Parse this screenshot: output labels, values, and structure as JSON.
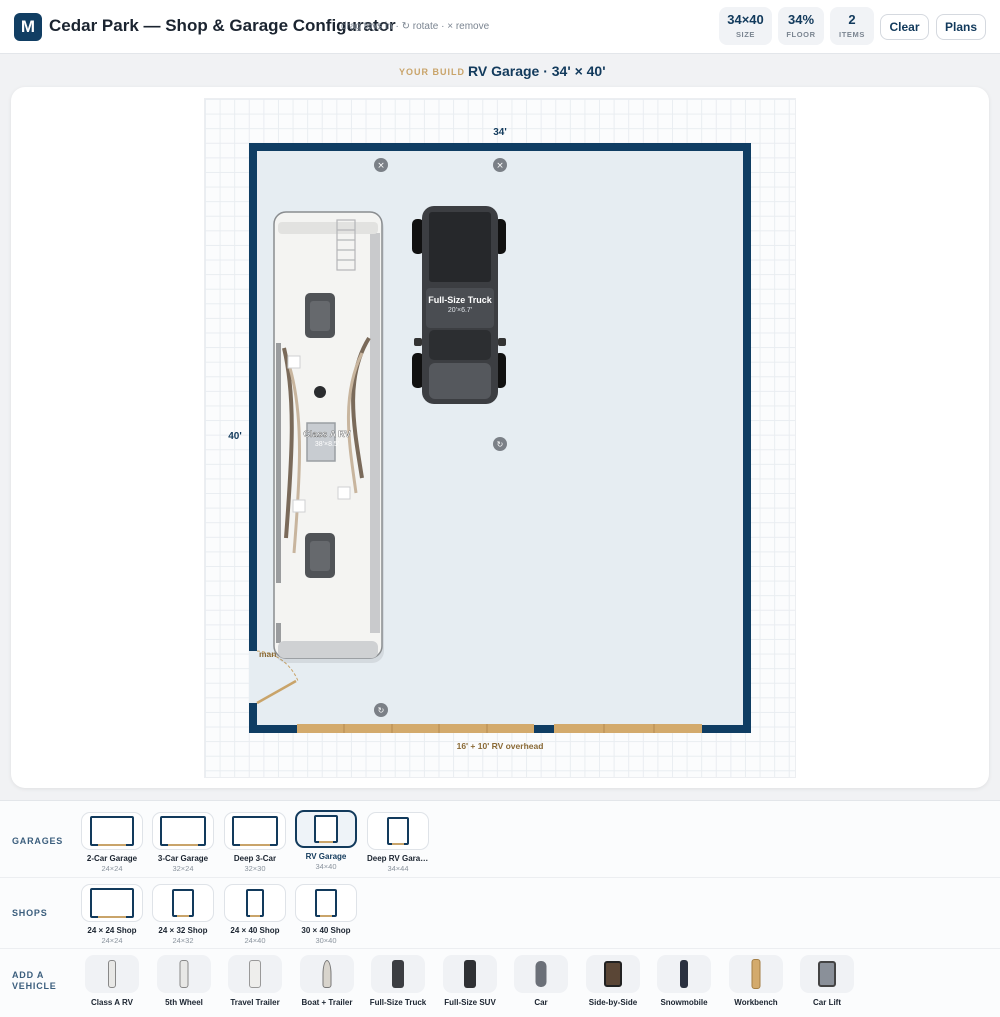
{
  "header": {
    "logo_letter": "M",
    "title": "Cedar Park — Shop & Garage Configurator",
    "hint": "drag toys in · ↻ rotate · × remove",
    "stats": [
      {
        "value": "34×40",
        "label": "SIZE"
      },
      {
        "value": "34%",
        "label": "FLOOR"
      },
      {
        "value": "2",
        "label": "ITEMS"
      }
    ],
    "clear_label": "Clear",
    "plans_label": "Plans"
  },
  "build": {
    "kicker": "YOUR BUILD",
    "name": "RV Garage · 34' × 40'"
  },
  "plan": {
    "width_label": "34'",
    "depth_label": "40'",
    "door_label": "man door",
    "overhead_label": "16' + 10' RV overhead",
    "items": [
      {
        "name": "Class A RV",
        "dims": "38'×8.5'"
      },
      {
        "name": "Full-Size Truck",
        "dims": "20'×6.7'"
      }
    ],
    "colors": {
      "wall": "#0f3d63",
      "floor": "#e6edf2",
      "door": "#d3aa6c"
    }
  },
  "garages": {
    "label": "GARAGES",
    "options": [
      {
        "name": "2-Car Garage",
        "dims": "24×24"
      },
      {
        "name": "3-Car Garage",
        "dims": "32×24"
      },
      {
        "name": "Deep 3-Car",
        "dims": "32×30"
      },
      {
        "name": "RV Garage",
        "dims": "34×40"
      },
      {
        "name": "Deep RV Garage",
        "dims": "34×44"
      }
    ]
  },
  "shops": {
    "label": "SHOPS",
    "options": [
      {
        "name": "24 × 24 Shop",
        "dims": "24×24"
      },
      {
        "name": "24 × 32 Shop",
        "dims": "24×32"
      },
      {
        "name": "24 × 40 Shop",
        "dims": "24×40"
      },
      {
        "name": "30 × 40 Shop",
        "dims": "30×40"
      }
    ]
  },
  "vehicles": {
    "label_line1": "ADD A",
    "label_line2": "VEHICLE",
    "options": [
      {
        "name": "Class A RV",
        "icon": "rv-icon"
      },
      {
        "name": "5th Wheel",
        "icon": "fifth-wheel-icon"
      },
      {
        "name": "Travel Trailer",
        "icon": "travel-trailer-icon"
      },
      {
        "name": "Boat + Trailer",
        "icon": "boat-icon"
      },
      {
        "name": "Full-Size Truck",
        "icon": "truck-icon"
      },
      {
        "name": "Full-Size SUV",
        "icon": "suv-icon"
      },
      {
        "name": "Car",
        "icon": "car-icon"
      },
      {
        "name": "Side-by-Side",
        "icon": "side-by-side-icon"
      },
      {
        "name": "Snowmobile",
        "icon": "snowmobile-icon"
      },
      {
        "name": "Workbench",
        "icon": "workbench-icon"
      },
      {
        "name": "Car Lift",
        "icon": "car-lift-icon"
      }
    ]
  }
}
